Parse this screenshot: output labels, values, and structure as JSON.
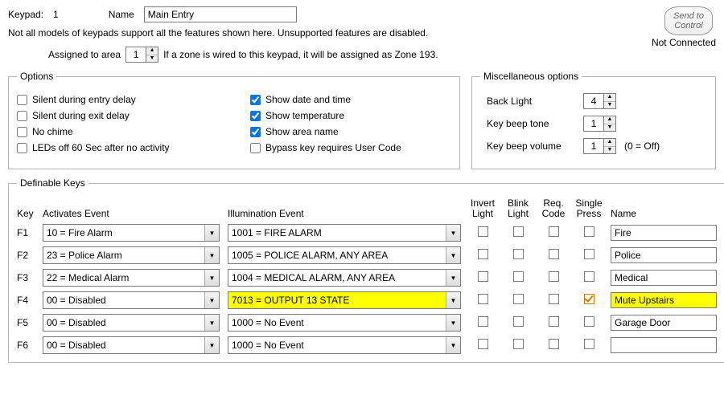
{
  "header": {
    "keypad_label": "Keypad:",
    "keypad_number": "1",
    "name_label": "Name",
    "name_value": "Main Entry",
    "note": "Not all models of keypads support all the features shown here.  Unsupported features are disabled.",
    "assigned_label": "Assigned to area",
    "assigned_value": "1",
    "assigned_suffix": "If a zone is wired to this keypad, it will be assigned as Zone 193.",
    "send_button": "Send to Control",
    "status": "Not Connected"
  },
  "options": {
    "legend": "Options",
    "left": [
      {
        "label": "Silent during entry delay",
        "checked": false
      },
      {
        "label": "Silent during exit delay",
        "checked": false
      },
      {
        "label": "No chime",
        "checked": false
      },
      {
        "label": "LEDs off 60 Sec after no activity",
        "checked": false
      }
    ],
    "right": [
      {
        "label": "Show date and time",
        "checked": true
      },
      {
        "label": "Show temperature",
        "checked": true
      },
      {
        "label": "Show area name",
        "checked": true
      },
      {
        "label": "Bypass key requires User Code",
        "checked": false
      }
    ]
  },
  "misc": {
    "legend": "Miscellaneous options",
    "rows": [
      {
        "label": "Back Light",
        "value": "4",
        "hint": ""
      },
      {
        "label": "Key beep tone",
        "value": "1",
        "hint": ""
      },
      {
        "label": "Key beep volume",
        "value": "1",
        "hint": "(0 = Off)"
      }
    ]
  },
  "definable": {
    "legend": "Definable Keys",
    "headers": {
      "key": "Key",
      "activates": "Activates Event",
      "illumination": "Illumination Event",
      "invert": "Invert Light",
      "blink": "Blink Light",
      "req": "Req. Code",
      "single": "Single Press",
      "name": "Name"
    },
    "rows": [
      {
        "key": "F1",
        "act": "10 = Fire Alarm",
        "ill": "1001 = FIRE ALARM",
        "invert": false,
        "blink": false,
        "req": false,
        "single": false,
        "name": "Fire",
        "hl": false
      },
      {
        "key": "F2",
        "act": "23 = Police Alarm",
        "ill": "1005 = POLICE ALARM, ANY AREA",
        "invert": false,
        "blink": false,
        "req": false,
        "single": false,
        "name": "Police",
        "hl": false
      },
      {
        "key": "F3",
        "act": "22 = Medical Alarm",
        "ill": "1004 = MEDICAL ALARM, ANY AREA",
        "invert": false,
        "blink": false,
        "req": false,
        "single": false,
        "name": "Medical",
        "hl": false
      },
      {
        "key": "F4",
        "act": "00 = Disabled",
        "ill": "7013 = OUTPUT 13 STATE",
        "invert": false,
        "blink": false,
        "req": false,
        "single": true,
        "name": "Mute Upstairs",
        "hl": true
      },
      {
        "key": "F5",
        "act": "00 = Disabled",
        "ill": "1000 = No Event",
        "invert": false,
        "blink": false,
        "req": false,
        "single": false,
        "name": "Garage Door",
        "hl": false
      },
      {
        "key": "F6",
        "act": "00 = Disabled",
        "ill": "1000 = No Event",
        "invert": false,
        "blink": false,
        "req": false,
        "single": false,
        "name": "",
        "hl": false
      }
    ]
  }
}
